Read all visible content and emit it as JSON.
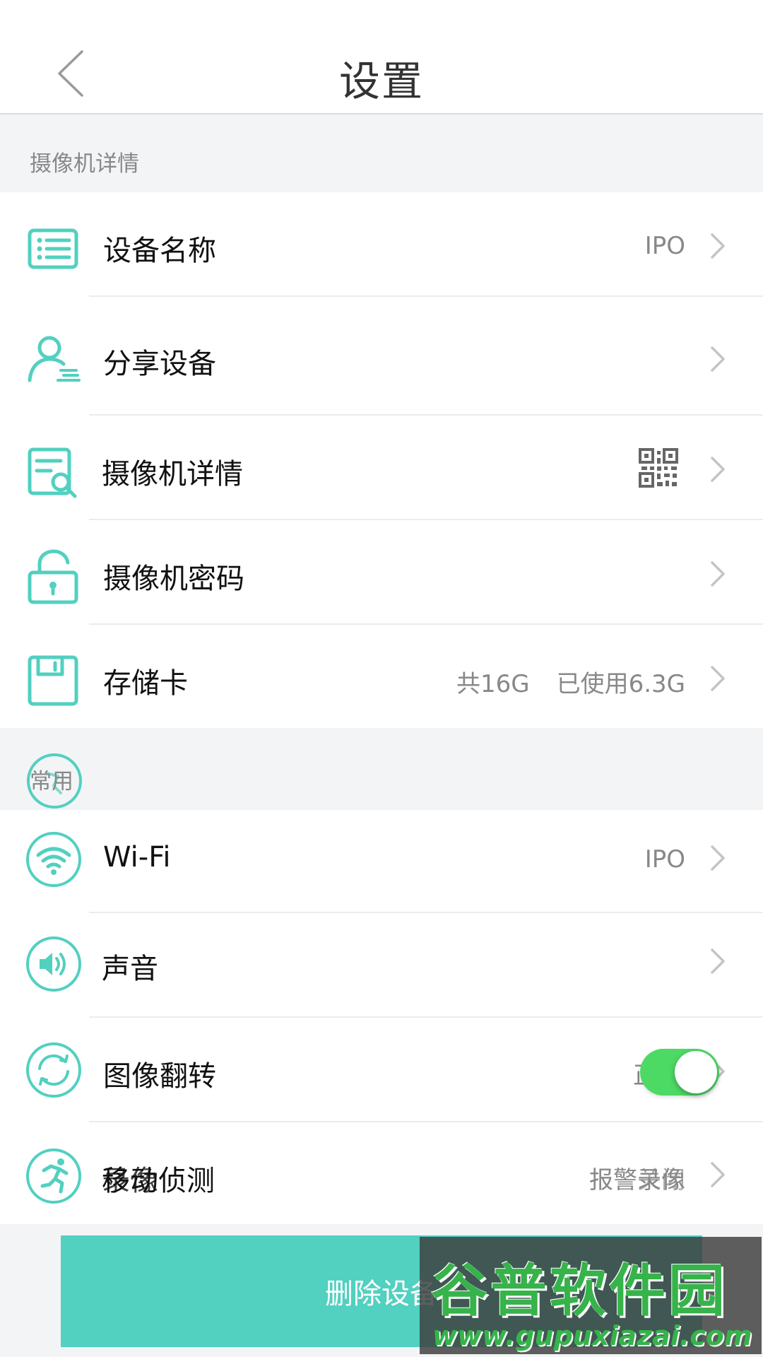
{
  "header": {
    "title": "设置"
  },
  "sections": {
    "camera": {
      "label": "摄像机详情",
      "rows": [
        {
          "label": "设备名称",
          "value": "IPO"
        },
        {
          "label": "分享设备"
        },
        {
          "label": "摄像机详情"
        },
        {
          "label": "摄像机密码"
        },
        {
          "label": "存储卡",
          "value_total": "共16G",
          "value_used": "已使用6.3G"
        }
      ]
    },
    "common": {
      "label": "常用",
      "rows": [
        {
          "label": "Wi-Fi",
          "value": "IPO"
        },
        {
          "label": "声音"
        },
        {
          "label": "图像翻转",
          "value_partial": "正",
          "toggle_on": true
        },
        {
          "label": "移动侦测",
          "label_overlap": "录像",
          "value": "报警录像",
          "value_overlap": "关闭"
        }
      ]
    }
  },
  "actions": {
    "delete_label": "删除设备"
  },
  "watermark": {
    "main": "谷普软件园",
    "url": "www.gupuxiazai.com"
  },
  "colors": {
    "accent": "#52d0c0",
    "toggle": "#4cd964"
  }
}
